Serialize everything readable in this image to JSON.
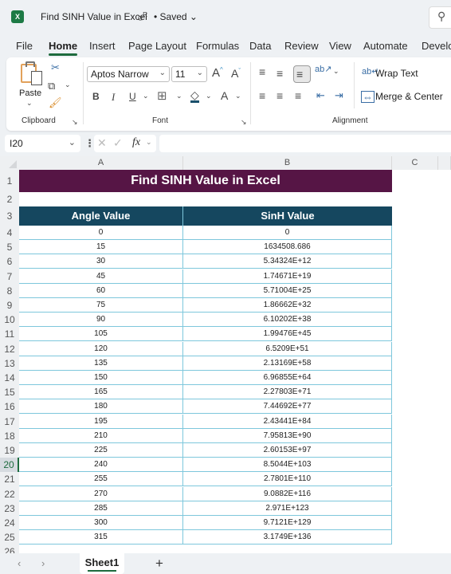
{
  "titlebar": {
    "app_icon": "excel-logo-icon",
    "doc_title": "Find SINH Value in Excel",
    "share_icon": "person-share-icon",
    "status": "• Saved",
    "status_chevron": "⌄",
    "search_icon": "⌕"
  },
  "menu": {
    "tabs": [
      {
        "label": "File"
      },
      {
        "label": "Home",
        "active": true
      },
      {
        "label": "Insert"
      },
      {
        "label": "Page Layout"
      },
      {
        "label": "Formulas"
      },
      {
        "label": "Data"
      },
      {
        "label": "Review"
      },
      {
        "label": "View"
      },
      {
        "label": "Automate"
      },
      {
        "label": "Develo"
      }
    ]
  },
  "ribbon": {
    "clipboard": {
      "label": "Clipboard",
      "paste_label": "Paste",
      "paste_chevron": "⌄",
      "cut_icon": "✂",
      "copy_icon": "⧉",
      "copy_chevron": "⌄",
      "format_painter_icon": "🖌"
    },
    "font": {
      "label": "Font",
      "font_name": "Aptos Narrow",
      "font_size": "11",
      "increase_font": "A^",
      "decrease_font": "Aˇ",
      "bold": "B",
      "italic": "I",
      "underline": "U",
      "chevron": "⌄",
      "borders_icon": "⊞",
      "fill_icon": "◇",
      "font_color": "A"
    },
    "alignment": {
      "label": "Alignment",
      "top_align": "≡",
      "middle_align": "≡",
      "bottom_align": "≡",
      "orientation_icon": "ab↗",
      "left_align": "≡",
      "center_align": "≡",
      "right_align": "≡",
      "decrease_indent": "⇤",
      "increase_indent": "⇥",
      "wrap_text": "Wrap Text",
      "wrap_icon": "ab↵",
      "merge_center": "Merge & Center",
      "merge_icon": "⇔",
      "merge_chevron": "⌄"
    }
  },
  "formula_bar": {
    "name_box": "I20",
    "name_chevron": "⌄",
    "more_icon": "⋮",
    "cancel_icon": "✕",
    "enter_icon": "✓",
    "fx_label": "fx",
    "fx_chevron": "⌄",
    "formula": ""
  },
  "sheet": {
    "columns": [
      "A",
      "B",
      "C"
    ],
    "selected_row": 20,
    "title": "Find SINH Value in Excel",
    "headers": [
      "Angle Value",
      "SinH Value"
    ],
    "rows": [
      [
        "0",
        "0"
      ],
      [
        "15",
        "1634508.686"
      ],
      [
        "30",
        "5.34324E+12"
      ],
      [
        "45",
        "1.74671E+19"
      ],
      [
        "60",
        "5.71004E+25"
      ],
      [
        "75",
        "1.86662E+32"
      ],
      [
        "90",
        "6.10202E+38"
      ],
      [
        "105",
        "1.99476E+45"
      ],
      [
        "120",
        "6.5209E+51"
      ],
      [
        "135",
        "2.13169E+58"
      ],
      [
        "150",
        "6.96855E+64"
      ],
      [
        "165",
        "2.27803E+71"
      ],
      [
        "180",
        "7.44692E+77"
      ],
      [
        "195",
        "2.43441E+84"
      ],
      [
        "210",
        "7.95813E+90"
      ],
      [
        "225",
        "2.60153E+97"
      ],
      [
        "240",
        "8.5044E+103"
      ],
      [
        "255",
        "2.7801E+110"
      ],
      [
        "270",
        "9.0882E+116"
      ],
      [
        "285",
        "2.971E+123"
      ],
      [
        "300",
        "9.7121E+129"
      ],
      [
        "315",
        "3.1749E+136"
      ]
    ],
    "colors": {
      "title_bg": "#561545",
      "header_bg": "#15475f",
      "border": "#7ec7dc"
    }
  },
  "tabs": {
    "prev_icon": "‹",
    "next_icon": "›",
    "sheets": [
      "Sheet1"
    ],
    "add_icon": "+"
  }
}
